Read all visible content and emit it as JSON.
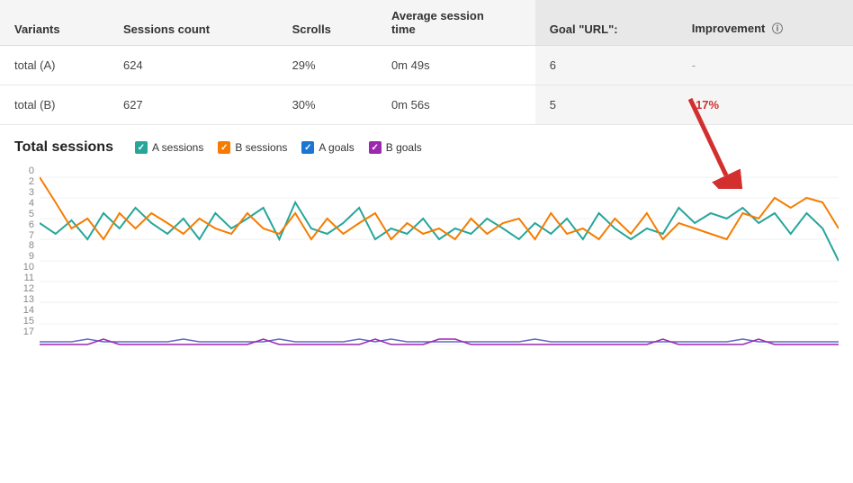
{
  "table": {
    "headers": {
      "variants": "Variants",
      "sessions_count": "Sessions count",
      "scrolls": "Scrolls",
      "avg_session_time": "Average session\ntime",
      "goal_url": "Goal \"URL\":",
      "improvement": "Improvement"
    },
    "rows": [
      {
        "variant": "total (A)",
        "sessions_count": "624",
        "scrolls": "29%",
        "avg_session_time": "0m 49s",
        "goal_url": "6",
        "improvement": "-",
        "improvement_type": "dash"
      },
      {
        "variant": "total (B)",
        "sessions_count": "627",
        "scrolls": "30%",
        "avg_session_time": "0m 56s",
        "goal_url": "5",
        "improvement": "-17%",
        "improvement_type": "negative"
      }
    ]
  },
  "chart": {
    "title": "Total sessions",
    "legend": [
      {
        "label": "A sessions",
        "color": "#26a69a",
        "type": "check"
      },
      {
        "label": "B sessions",
        "color": "#f57c00",
        "type": "check"
      },
      {
        "label": "A goals",
        "color": "#1976d2",
        "type": "check"
      },
      {
        "label": "B goals",
        "color": "#9c27b0",
        "type": "check"
      }
    ],
    "y_labels": [
      "0",
      "2",
      "3",
      "4",
      "5",
      "6",
      "7",
      "8",
      "9",
      "10",
      "11",
      "12",
      "13",
      "14",
      "15",
      "17"
    ],
    "improvement_icon": "ℹ"
  }
}
